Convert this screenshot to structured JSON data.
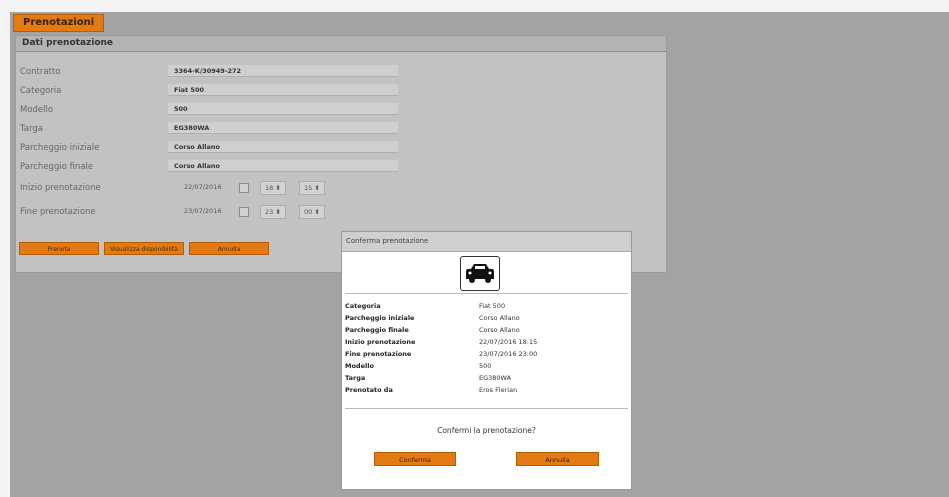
{
  "app": {
    "tab_label": "Prenotazioni"
  },
  "form": {
    "section_title": "Dati prenotazione",
    "fields": [
      {
        "label": "Contratto",
        "value": "3364-K/30949-272"
      },
      {
        "label": "Categoria",
        "value": "Fiat 500"
      },
      {
        "label": "Modello",
        "value": "500"
      },
      {
        "label": "Targa",
        "value": "EG380WA"
      },
      {
        "label": "Parcheggio iniziale",
        "value": "Corso Allano"
      },
      {
        "label": "Parcheggio finale",
        "value": "Corso Allano"
      }
    ],
    "start": {
      "label": "Inizio prenotazione",
      "date": "22/07/2016",
      "hour": "18",
      "minute": "15"
    },
    "end": {
      "label": "Fine prenotazione",
      "date": "23/07/2016",
      "hour": "23",
      "minute": "00"
    },
    "buttons": {
      "prenota": "Prenota",
      "disponibilita": "Visualizza disponibilità",
      "annulla": "Annulla"
    }
  },
  "modal": {
    "title": "Conferma prenotazione",
    "icon": "car-icon",
    "details": [
      {
        "key": "Categoria",
        "value": "Fiat 500"
      },
      {
        "key": "Parcheggio iniziale",
        "value": "Corso Allano"
      },
      {
        "key": "Parcheggio finale",
        "value": "Corso Allano"
      },
      {
        "key": "Inizio prenotazione",
        "value": "22/07/2016 18:15"
      },
      {
        "key": "Fine prenotazione",
        "value": "23/07/2016 23:00"
      },
      {
        "key": "Modello",
        "value": "500"
      },
      {
        "key": "Targa",
        "value": "EG380WA"
      },
      {
        "key": "Prenotato da",
        "value": "Eros Flerian"
      }
    ],
    "question": "Confermi la prenotazione?",
    "confirm_label": "Conferma",
    "cancel_label": "Annulla"
  },
  "colors": {
    "accent": "#e37a14",
    "backdrop": "#a3a3a3"
  }
}
